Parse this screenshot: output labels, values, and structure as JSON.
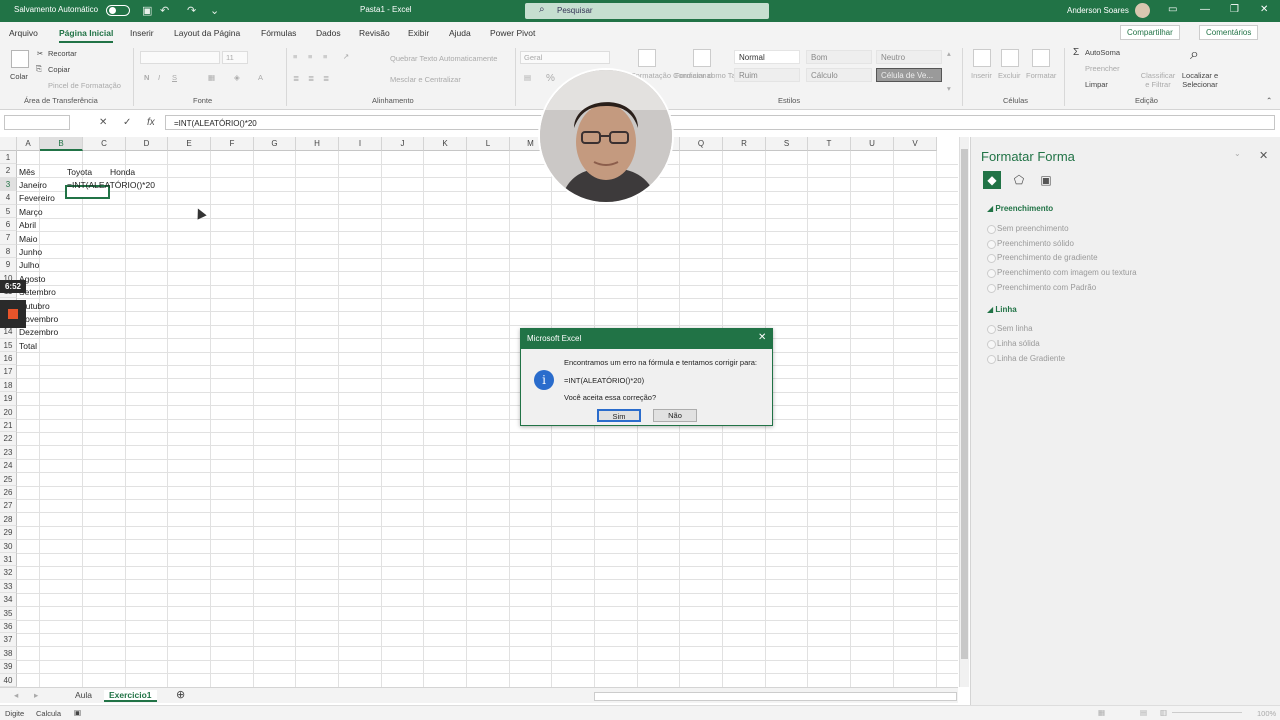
{
  "titlebar": {
    "autosave": "Salvamento Automático",
    "doc": "Pasta1  -  Excel",
    "search": "Pesquisar",
    "user": "Anderson Soares"
  },
  "tabs": [
    "Arquivo",
    "Página Inicial",
    "Inserir",
    "Layout da Página",
    "Fórmulas",
    "Dados",
    "Revisão",
    "Exibir",
    "Ajuda",
    "Power Pivot"
  ],
  "tab_active": "Página Inicial",
  "share": "Compartilhar",
  "comments": "Comentários",
  "ribbon": {
    "clipboard": {
      "paste": "Colar",
      "cut": "Recortar",
      "copy": "Copiar",
      "painter": "Pincel de Formatação",
      "label": "Área de Transferência"
    },
    "font": {
      "size": "11",
      "label": "Fonte"
    },
    "alignment": {
      "wrap": "Quebrar Texto Automaticamente",
      "merge": "Mesclar e Centralizar",
      "label": "Alinhamento"
    },
    "number": {
      "format": "Geral"
    },
    "styles": {
      "conditional": "Formatação Condicional",
      "as_table": "Formatar como Tabela",
      "cells": [
        "Normal",
        "Bom",
        "Neutro",
        "Ruim",
        "Cálculo",
        "Célula de Ve..."
      ],
      "label": "Estilos"
    },
    "cells": {
      "insert": "Inserir",
      "delete": "Excluir",
      "format": "Formatar",
      "label": "Células"
    },
    "editing": {
      "autosum": "AutoSoma",
      "fill": "Preencher",
      "clear": "Limpar",
      "sort": "Classificar e Filtrar",
      "find": "Localizar e Selecionar",
      "label": "Edição"
    }
  },
  "formula_bar": {
    "content": "=INT(ALEATÓRIO()*20"
  },
  "columns": [
    "A",
    "B",
    "C",
    "D",
    "E",
    "F",
    "G",
    "H",
    "I",
    "J",
    "K",
    "L",
    "M",
    "N",
    "O",
    "P",
    "Q",
    "R",
    "S",
    "T",
    "U",
    "V"
  ],
  "rows": [
    "1",
    "2",
    "3",
    "4",
    "5",
    "6",
    "7",
    "8",
    "9",
    "10",
    "11",
    "12",
    "13",
    "14",
    "15",
    "16",
    "17",
    "18",
    "19",
    "20",
    "21",
    "22",
    "23",
    "24",
    "25",
    "26",
    "27",
    "28",
    "29",
    "30",
    "31",
    "32",
    "33",
    "34",
    "35",
    "36",
    "37",
    "38",
    "39",
    "40"
  ],
  "cells": {
    "a2": "Mês",
    "b2": "Toyota",
    "c2": "Honda",
    "b3": "=INT(ALEATÓRIO()*20",
    "months": [
      "Janeiro",
      "Fevereiro",
      "Março",
      "Abril",
      "Maio",
      "Junho",
      "Julho",
      "Agosto",
      "Setembro",
      "Outubro",
      "Novembro",
      "Dezembro",
      "Total"
    ]
  },
  "sheets": [
    "Aula",
    "Exercicio1"
  ],
  "sheet_active": "Exercicio1",
  "status": {
    "mode": "Digite",
    "calc": "Calcula",
    "zoom": "100%"
  },
  "pane": {
    "title": "Formatar Forma",
    "fill_section": "Preenchimento",
    "fill_options": [
      "Sem preenchimento",
      "Preenchimento sólido",
      "Preenchimento de gradiente",
      "Preenchimento com imagem ou textura",
      "Preenchimento com Padrão"
    ],
    "line_section": "Linha",
    "line_options": [
      "Sem linha",
      "Linha sólida",
      "Linha de Gradiente"
    ]
  },
  "recorder": {
    "time": "6:52"
  },
  "dialog": {
    "title": "Microsoft Excel",
    "line1": "Encontramos um erro na fórmula e tentamos corrigir para:",
    "formula": "=INT(ALEATÓRIO()*20)",
    "line3": "Você aceita essa correção?",
    "yes": "Sim",
    "no": "Não"
  },
  "colors": {
    "accent": "#217346",
    "info": "#2a6ccc",
    "stop": "#e8542a"
  }
}
